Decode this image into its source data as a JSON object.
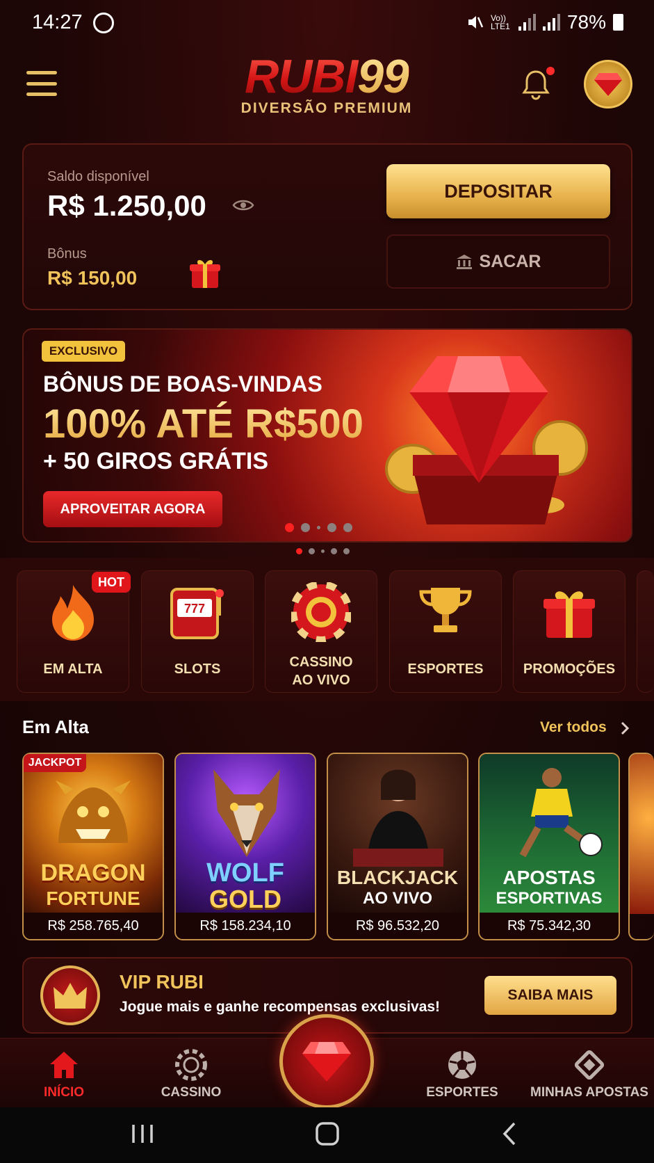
{
  "status_bar": {
    "time": "14:27",
    "battery": "78%",
    "network": "Vo)) LTE1"
  },
  "header": {
    "logo_text": "RUBI",
    "logo_num": "99",
    "tagline": "DIVERSÃO PREMIUM"
  },
  "wallet": {
    "balance_label": "Saldo disponível",
    "balance": "R$ 1.250,00",
    "bonus_label": "Bônus",
    "bonus": "R$ 150,00",
    "deposit_label": "DEPOSITAR",
    "withdraw_label": "SACAR"
  },
  "banner": {
    "badge": "EXCLUSIVO",
    "line1": "BÔNUS DE BOAS-VINDAS",
    "line2": "100% ATÉ R$500",
    "line3": "+ 50 GIROS GRÁTIS",
    "cta": "APROVEITAR AGORA"
  },
  "categories": [
    {
      "label": "EM ALTA",
      "icon": "flame-icon",
      "badge": "HOT"
    },
    {
      "label": "SLOTS",
      "icon": "slot-machine-icon"
    },
    {
      "label": "CASSINO AO VIVO",
      "icon": "casino-chip-icon"
    },
    {
      "label": "ESPORTES",
      "icon": "trophy-icon"
    },
    {
      "label": "PROMOÇÕES",
      "icon": "gift-icon"
    }
  ],
  "trending": {
    "title": "Em Alta",
    "see_all": "Ver todos",
    "games": [
      {
        "name1": "DRAGON",
        "name2": "FORTUNE",
        "price": "R$ 258.765,40",
        "badge": "JACKPOT"
      },
      {
        "name1": "WOLF",
        "name2": "GOLD",
        "price": "R$ 158.234,10"
      },
      {
        "name1": "BLACKJACK",
        "name2": "AO VIVO",
        "price": "R$ 96.532,20"
      },
      {
        "name1": "APOSTAS",
        "name2": "ESPORTIVAS",
        "price": "R$ 75.342,30"
      }
    ]
  },
  "vip": {
    "title": "VIP RUBI",
    "subtitle": "Jogue mais e ganhe recompensas exclusivas!",
    "cta": "SAIBA MAIS"
  },
  "bottom_nav": [
    {
      "label": "INÍCIO",
      "icon": "home-icon",
      "active": true
    },
    {
      "label": "CASSINO",
      "icon": "chip-icon"
    },
    {
      "label": "ESPORTES",
      "icon": "soccer-ball-icon"
    },
    {
      "label": "MINHAS APOSTAS",
      "icon": "ticket-icon"
    }
  ],
  "colors": {
    "accent_gold": "#f0c35b",
    "accent_red": "#e0161b",
    "background": "#1e0606"
  }
}
